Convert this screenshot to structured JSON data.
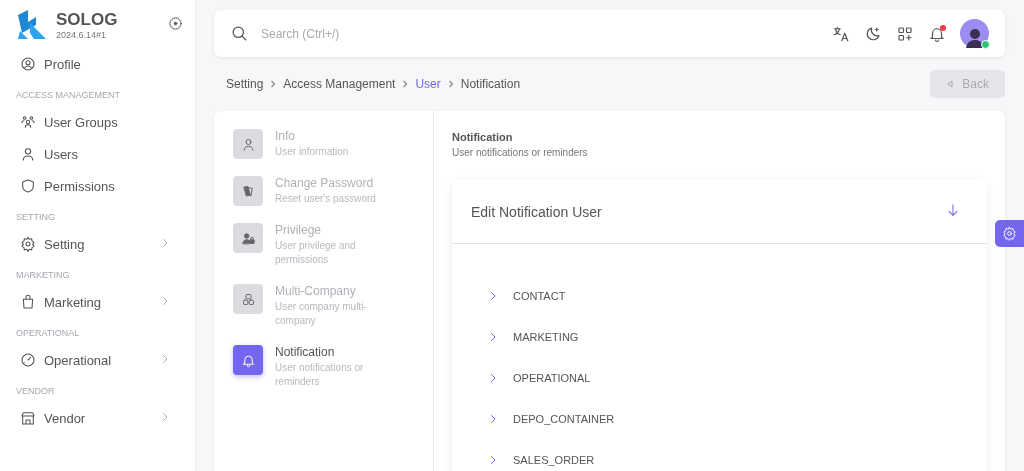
{
  "sidebar": {
    "brand": {
      "name": "SOLOG",
      "version": "2024.6.14#1"
    },
    "sections": [
      {
        "items": [
          {
            "label": "Profile",
            "has_submenu": false
          }
        ]
      },
      {
        "header": "ACCESS MANAGEMENT",
        "items": [
          {
            "label": "User Groups",
            "has_submenu": false
          },
          {
            "label": "Users",
            "has_submenu": false
          },
          {
            "label": "Permissions",
            "has_submenu": false
          }
        ]
      },
      {
        "header": "SETTING",
        "items": [
          {
            "label": "Setting",
            "has_submenu": true
          }
        ]
      },
      {
        "header": "MARKETING",
        "items": [
          {
            "label": "Marketing",
            "has_submenu": true
          }
        ]
      },
      {
        "header": "OPERATIONAL",
        "items": [
          {
            "label": "Operational",
            "has_submenu": true
          }
        ]
      },
      {
        "header": "VENDOR",
        "items": [
          {
            "label": "Vendor",
            "has_submenu": true
          }
        ]
      }
    ]
  },
  "topbar": {
    "search": {
      "placeholder": "Search (Ctrl+/)"
    },
    "notifications_unread": true,
    "user_online": true
  },
  "breadcrumb": [
    {
      "label": "Setting",
      "kind": "text"
    },
    {
      "label": "Access Management",
      "kind": "text"
    },
    {
      "label": "User",
      "kind": "link"
    },
    {
      "label": "Notification",
      "kind": "current"
    }
  ],
  "back_button": {
    "label": "Back",
    "disabled": true
  },
  "nav": [
    {
      "title": "Info",
      "subtitle": "User information",
      "selected": false
    },
    {
      "title": "Change Password",
      "subtitle": "Reset user's password",
      "selected": false
    },
    {
      "title": "Privilege",
      "subtitle": "User privilege and permissions",
      "selected": false
    },
    {
      "title": "Multi-Company",
      "subtitle": "User company multi-company",
      "selected": false
    },
    {
      "title": "Notification",
      "subtitle": "User notifications or reminders",
      "selected": true
    }
  ],
  "panel": {
    "title": "Notification",
    "subtitle": "User notifications or reminders",
    "card": {
      "title": "Edit Notification User",
      "items": [
        {
          "label": "CONTACT",
          "expanded": false
        },
        {
          "label": "MARKETING",
          "expanded": false
        },
        {
          "label": "OPERATIONAL",
          "expanded": false
        },
        {
          "label": "DEPO_CONTAINER",
          "expanded": false
        },
        {
          "label": "SALES_ORDER",
          "expanded": false
        }
      ]
    }
  }
}
